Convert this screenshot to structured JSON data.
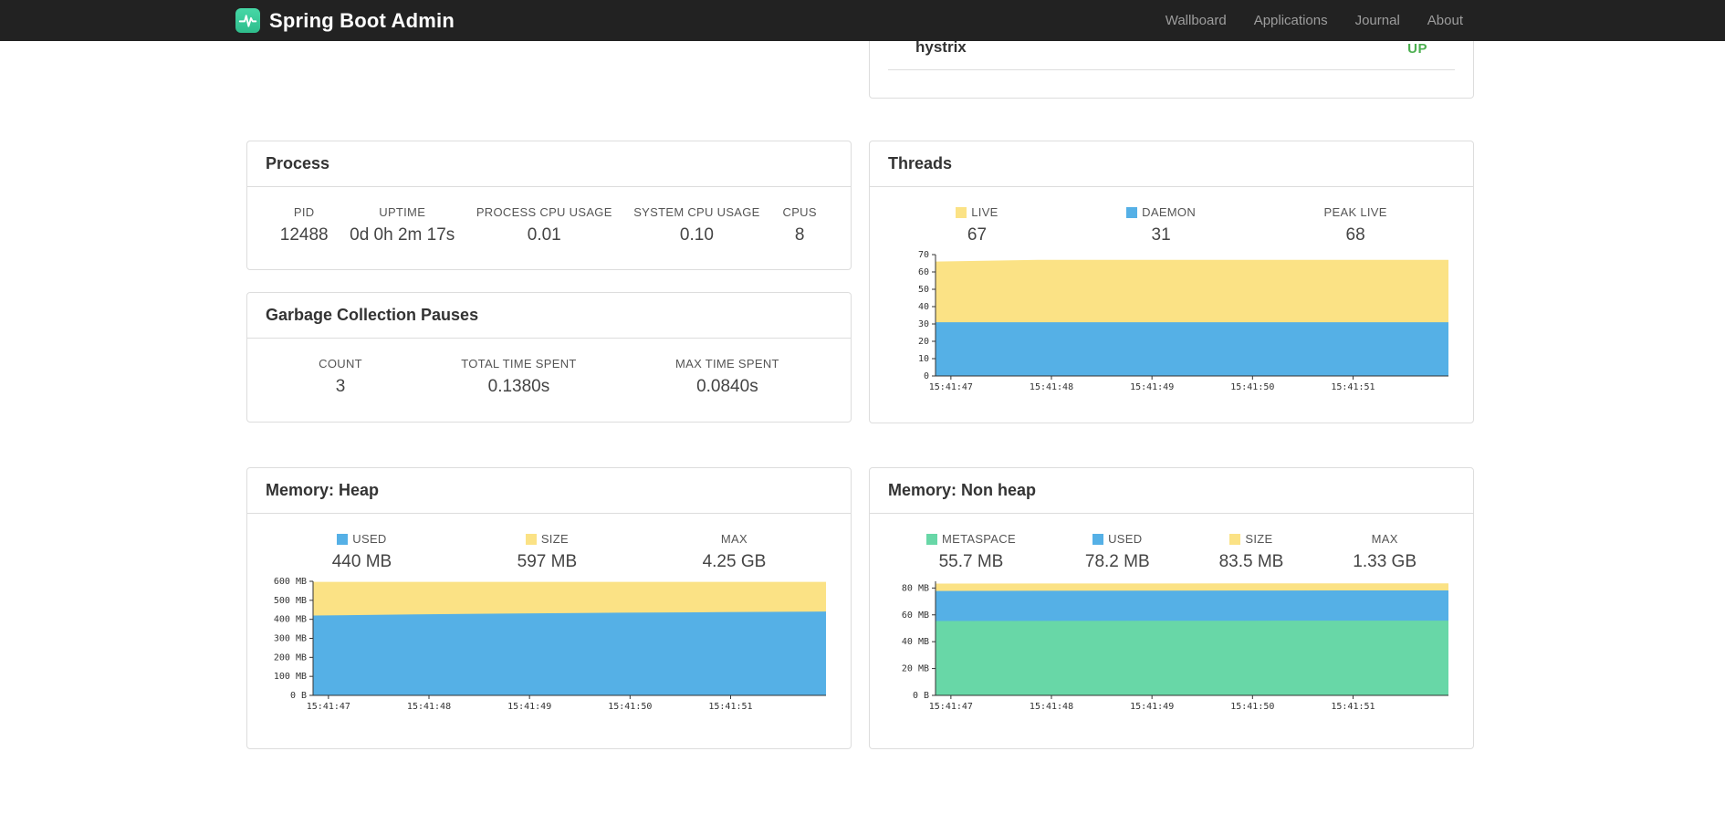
{
  "navbar": {
    "brand": "Spring Boot Admin",
    "items": [
      {
        "label": "Wallboard"
      },
      {
        "label": "Applications"
      },
      {
        "label": "Journal"
      },
      {
        "label": "About"
      }
    ]
  },
  "status_panel": {
    "service": "hystrix",
    "status": "UP",
    "status_color": "#4caf50"
  },
  "process": {
    "title": "Process",
    "stats": [
      {
        "label": "PID",
        "value": "12488"
      },
      {
        "label": "UPTIME",
        "value": "0d 0h 2m 17s"
      },
      {
        "label": "PROCESS CPU USAGE",
        "value": "0.01"
      },
      {
        "label": "SYSTEM CPU USAGE",
        "value": "0.10"
      },
      {
        "label": "CPUS",
        "value": "8"
      }
    ]
  },
  "gc": {
    "title": "Garbage Collection Pauses",
    "stats": [
      {
        "label": "COUNT",
        "value": "3"
      },
      {
        "label": "TOTAL TIME SPENT",
        "value": "0.1380s"
      },
      {
        "label": "MAX TIME SPENT",
        "value": "0.0840s"
      }
    ]
  },
  "threads": {
    "title": "Threads",
    "stats": [
      {
        "label": "LIVE",
        "value": "67",
        "swatch": "#fbe285"
      },
      {
        "label": "DAEMON",
        "value": "31",
        "swatch": "#55b0e6"
      },
      {
        "label": "PEAK LIVE",
        "value": "68"
      }
    ]
  },
  "heap": {
    "title": "Memory: Heap",
    "stats": [
      {
        "label": "USED",
        "value": "440 MB",
        "swatch": "#55b0e6"
      },
      {
        "label": "SIZE",
        "value": "597 MB",
        "swatch": "#fbe285"
      },
      {
        "label": "MAX",
        "value": "4.25 GB"
      }
    ]
  },
  "nonheap": {
    "title": "Memory: Non heap",
    "stats": [
      {
        "label": "METASPACE",
        "value": "55.7 MB",
        "swatch": "#68d7a7"
      },
      {
        "label": "USED",
        "value": "78.2 MB",
        "swatch": "#55b0e6"
      },
      {
        "label": "SIZE",
        "value": "83.5 MB",
        "swatch": "#fbe285"
      },
      {
        "label": "MAX",
        "value": "1.33 GB"
      }
    ]
  },
  "chart_data": [
    {
      "id": "threads",
      "type": "area",
      "title": "Threads",
      "x": [
        "15:41:47",
        "15:41:48",
        "15:41:49",
        "15:41:50",
        "15:41:51"
      ],
      "ylim": [
        0,
        70
      ],
      "yticks": [
        {
          "v": 0,
          "label": "0"
        },
        {
          "v": 10,
          "label": "10"
        },
        {
          "v": 20,
          "label": "20"
        },
        {
          "v": 30,
          "label": "30"
        },
        {
          "v": 40,
          "label": "40"
        },
        {
          "v": 50,
          "label": "50"
        },
        {
          "v": 60,
          "label": "60"
        },
        {
          "v": 70,
          "label": "70"
        }
      ],
      "series": [
        {
          "name": "LIVE",
          "color": "#fbe285",
          "values": [
            66,
            67,
            67,
            67,
            67,
            67
          ]
        },
        {
          "name": "DAEMON",
          "color": "#55b0e6",
          "values": [
            31,
            31,
            31,
            31,
            31,
            31
          ]
        }
      ],
      "legend_position": "top",
      "grid": false
    },
    {
      "id": "memory-heap",
      "type": "area",
      "title": "Memory: Heap",
      "x": [
        "15:41:47",
        "15:41:48",
        "15:41:49",
        "15:41:50",
        "15:41:51"
      ],
      "ylim": [
        0,
        600
      ],
      "yticks": [
        {
          "v": 0,
          "label": "0 B"
        },
        {
          "v": 100,
          "label": "100 MB"
        },
        {
          "v": 200,
          "label": "200 MB"
        },
        {
          "v": 300,
          "label": "300 MB"
        },
        {
          "v": 400,
          "label": "400 MB"
        },
        {
          "v": 500,
          "label": "500 MB"
        },
        {
          "v": 600,
          "label": "600 MB"
        }
      ],
      "series": [
        {
          "name": "SIZE",
          "color": "#fbe285",
          "values": [
            597,
            597,
            597,
            597,
            597,
            597
          ]
        },
        {
          "name": "USED",
          "color": "#55b0e6",
          "values": [
            420,
            426,
            431,
            435,
            438,
            441
          ]
        }
      ],
      "legend_position": "top",
      "grid": false
    },
    {
      "id": "memory-nonheap",
      "type": "area",
      "title": "Memory: Non heap",
      "x": [
        "15:41:47",
        "15:41:48",
        "15:41:49",
        "15:41:50",
        "15:41:51"
      ],
      "ylim": [
        0,
        85
      ],
      "yticks": [
        {
          "v": 0,
          "label": "0 B"
        },
        {
          "v": 20,
          "label": "20 MB"
        },
        {
          "v": 40,
          "label": "40 MB"
        },
        {
          "v": 60,
          "label": "60 MB"
        },
        {
          "v": 80,
          "label": "80 MB"
        }
      ],
      "series": [
        {
          "name": "SIZE",
          "color": "#fbe285",
          "values": [
            83.3,
            83.4,
            83.4,
            83.5,
            83.5,
            83.5
          ]
        },
        {
          "name": "USED",
          "color": "#55b0e6",
          "values": [
            77.8,
            77.9,
            78.0,
            78.1,
            78.2,
            78.2
          ]
        },
        {
          "name": "METASPACE",
          "color": "#68d7a7",
          "values": [
            55.4,
            55.5,
            55.6,
            55.6,
            55.7,
            55.7
          ]
        }
      ],
      "legend_position": "top",
      "grid": false
    }
  ]
}
